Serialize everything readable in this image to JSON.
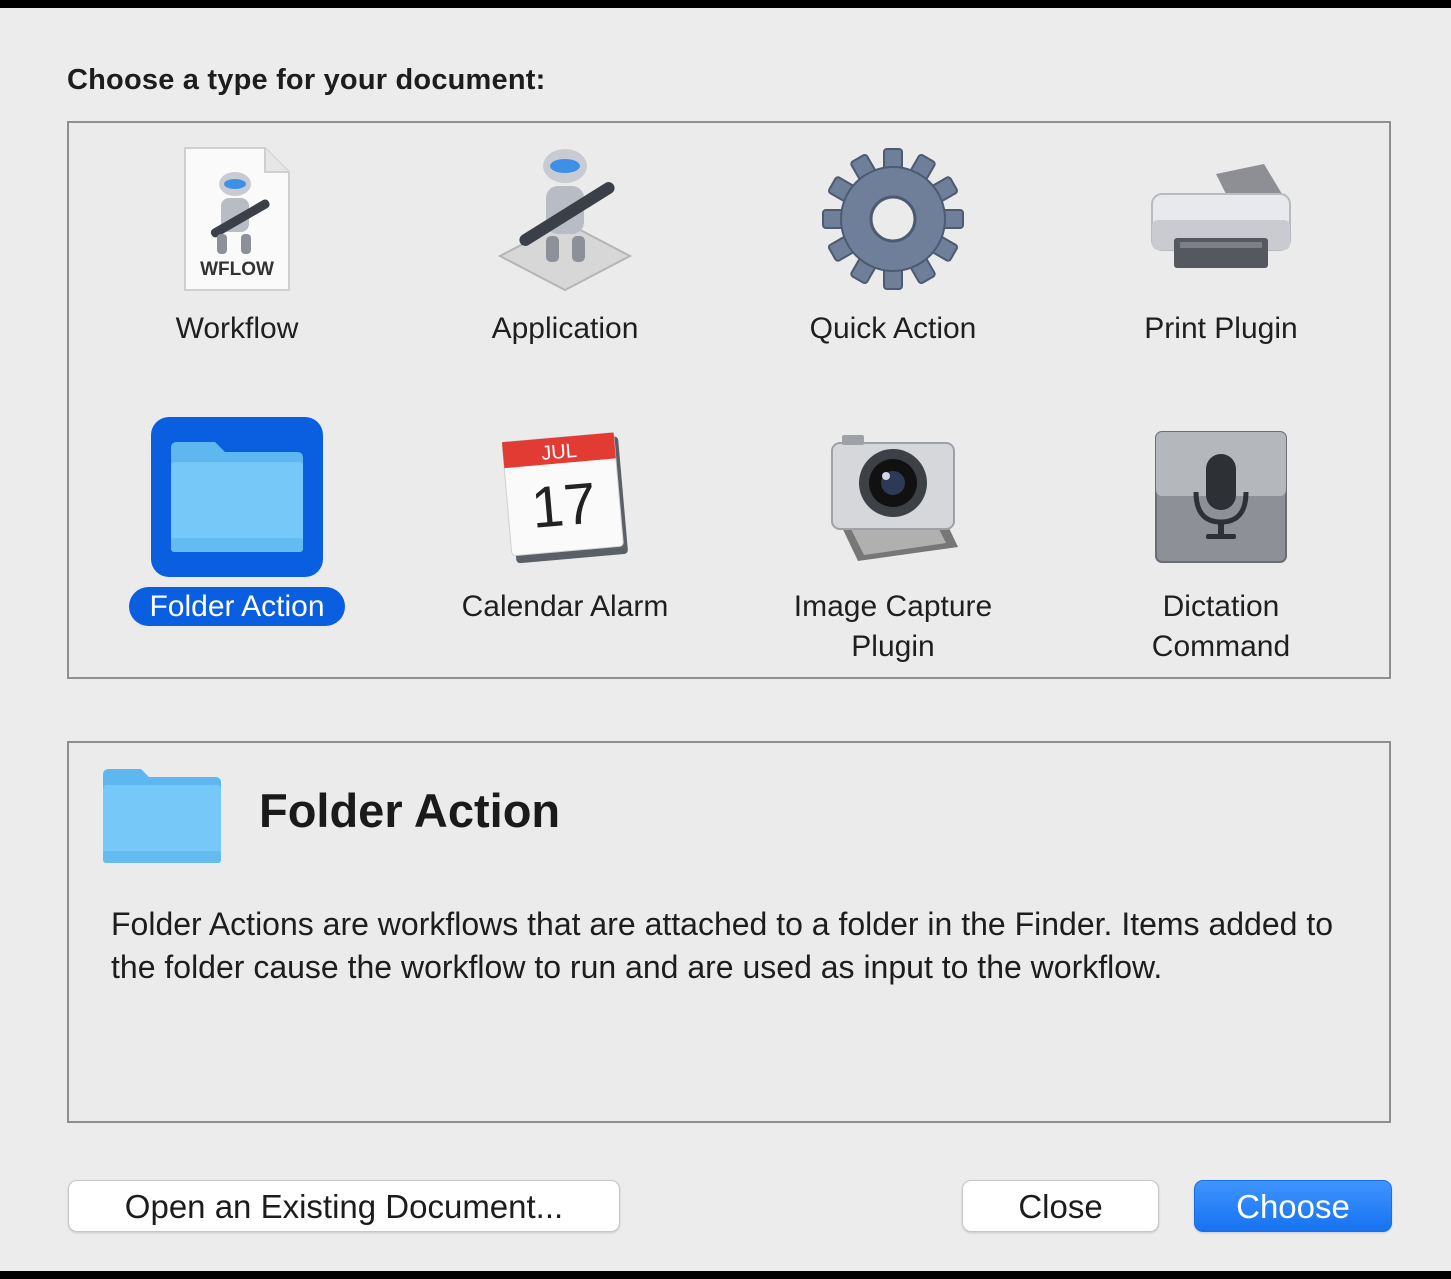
{
  "heading": "Choose a type for your document:",
  "types": [
    {
      "label": "Workflow",
      "icon": "wflow-document-icon",
      "badge": "WFLOW"
    },
    {
      "label": "Application",
      "icon": "automator-robot-icon"
    },
    {
      "label": "Quick Action",
      "icon": "gear-icon"
    },
    {
      "label": "Print Plugin",
      "icon": "printer-icon"
    },
    {
      "label": "Folder Action",
      "icon": "folder-icon",
      "selected": true
    },
    {
      "label": "Calendar Alarm",
      "icon": "calendar-icon",
      "month": "JUL",
      "day": "17"
    },
    {
      "label": "Image Capture Plugin",
      "line1": "Image Capture",
      "line2": "Plugin",
      "icon": "camera-icon"
    },
    {
      "label": "Dictation Command",
      "line1": "Dictation",
      "line2": "Command",
      "icon": "microphone-icon"
    }
  ],
  "description": {
    "title": "Folder Action",
    "icon": "folder-icon",
    "text": "Folder Actions are workflows that are attached to a folder in the Finder. Items added to the folder cause the workflow to run and are used as input to the workflow."
  },
  "buttons": {
    "open": "Open an Existing Document...",
    "close": "Close",
    "choose": "Choose"
  },
  "colors": {
    "accent": "#0a5fe0",
    "folder": "#6ec6f7"
  }
}
